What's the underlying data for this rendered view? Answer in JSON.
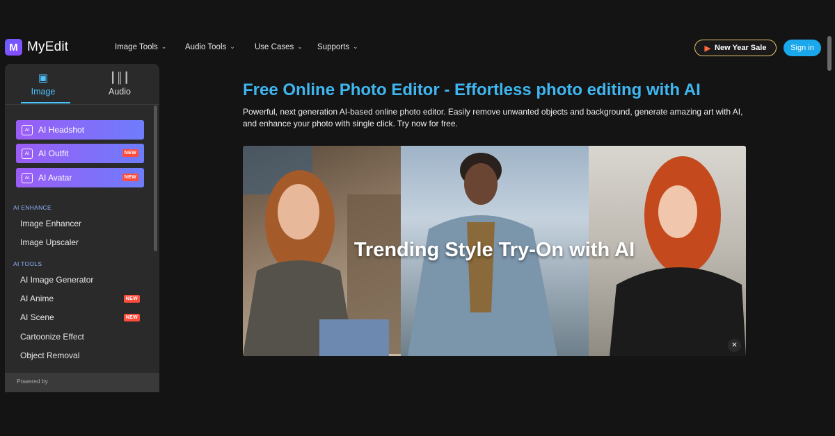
{
  "app": {
    "name": "MyEdit",
    "logo_letter": "M"
  },
  "nav": [
    {
      "label": "Image Tools"
    },
    {
      "label": "Audio Tools"
    },
    {
      "label": "Use Cases"
    },
    {
      "label": "Supports"
    }
  ],
  "header": {
    "sale_label": "New Year Sale",
    "signin_label": "Sign in"
  },
  "sidebar": {
    "tabs": [
      {
        "label": "Image",
        "icon": "image-icon",
        "active": true
      },
      {
        "label": "Audio",
        "icon": "waveform-icon",
        "active": false
      }
    ],
    "features": [
      {
        "label": "AI Headshot",
        "new": false
      },
      {
        "label": "AI Outfit",
        "new": true
      },
      {
        "label": "AI Avatar",
        "new": true
      }
    ],
    "new_label": "NEW",
    "sections": [
      {
        "title": "AI ENHANCE",
        "items": [
          {
            "label": "Image Enhancer"
          },
          {
            "label": "Image Upscaler"
          }
        ]
      },
      {
        "title": "AI TOOLS",
        "items": [
          {
            "label": "AI Image Generator",
            "new": false
          },
          {
            "label": "AI Anime",
            "new": true
          },
          {
            "label": "AI Scene",
            "new": true
          },
          {
            "label": "Cartoonize Effect",
            "new": false
          },
          {
            "label": "Object Removal",
            "new": false
          }
        ]
      }
    ],
    "powered_by": "Powered by"
  },
  "main": {
    "title": "Free Online Photo Editor - Effortless photo editing with AI",
    "description": "Powerful, next generation AI-based online photo editor. Easily remove unwanted objects and background, generate amazing art with AI, and enhance your photo with single click. Try now for free.",
    "banner_text": "Trending Style Try-On with AI"
  },
  "colors": {
    "accent": "#3fb6f0",
    "signin": "#1aa7ec",
    "sale_border": "#e8c26a",
    "new_badge": "#ff4d3d"
  }
}
